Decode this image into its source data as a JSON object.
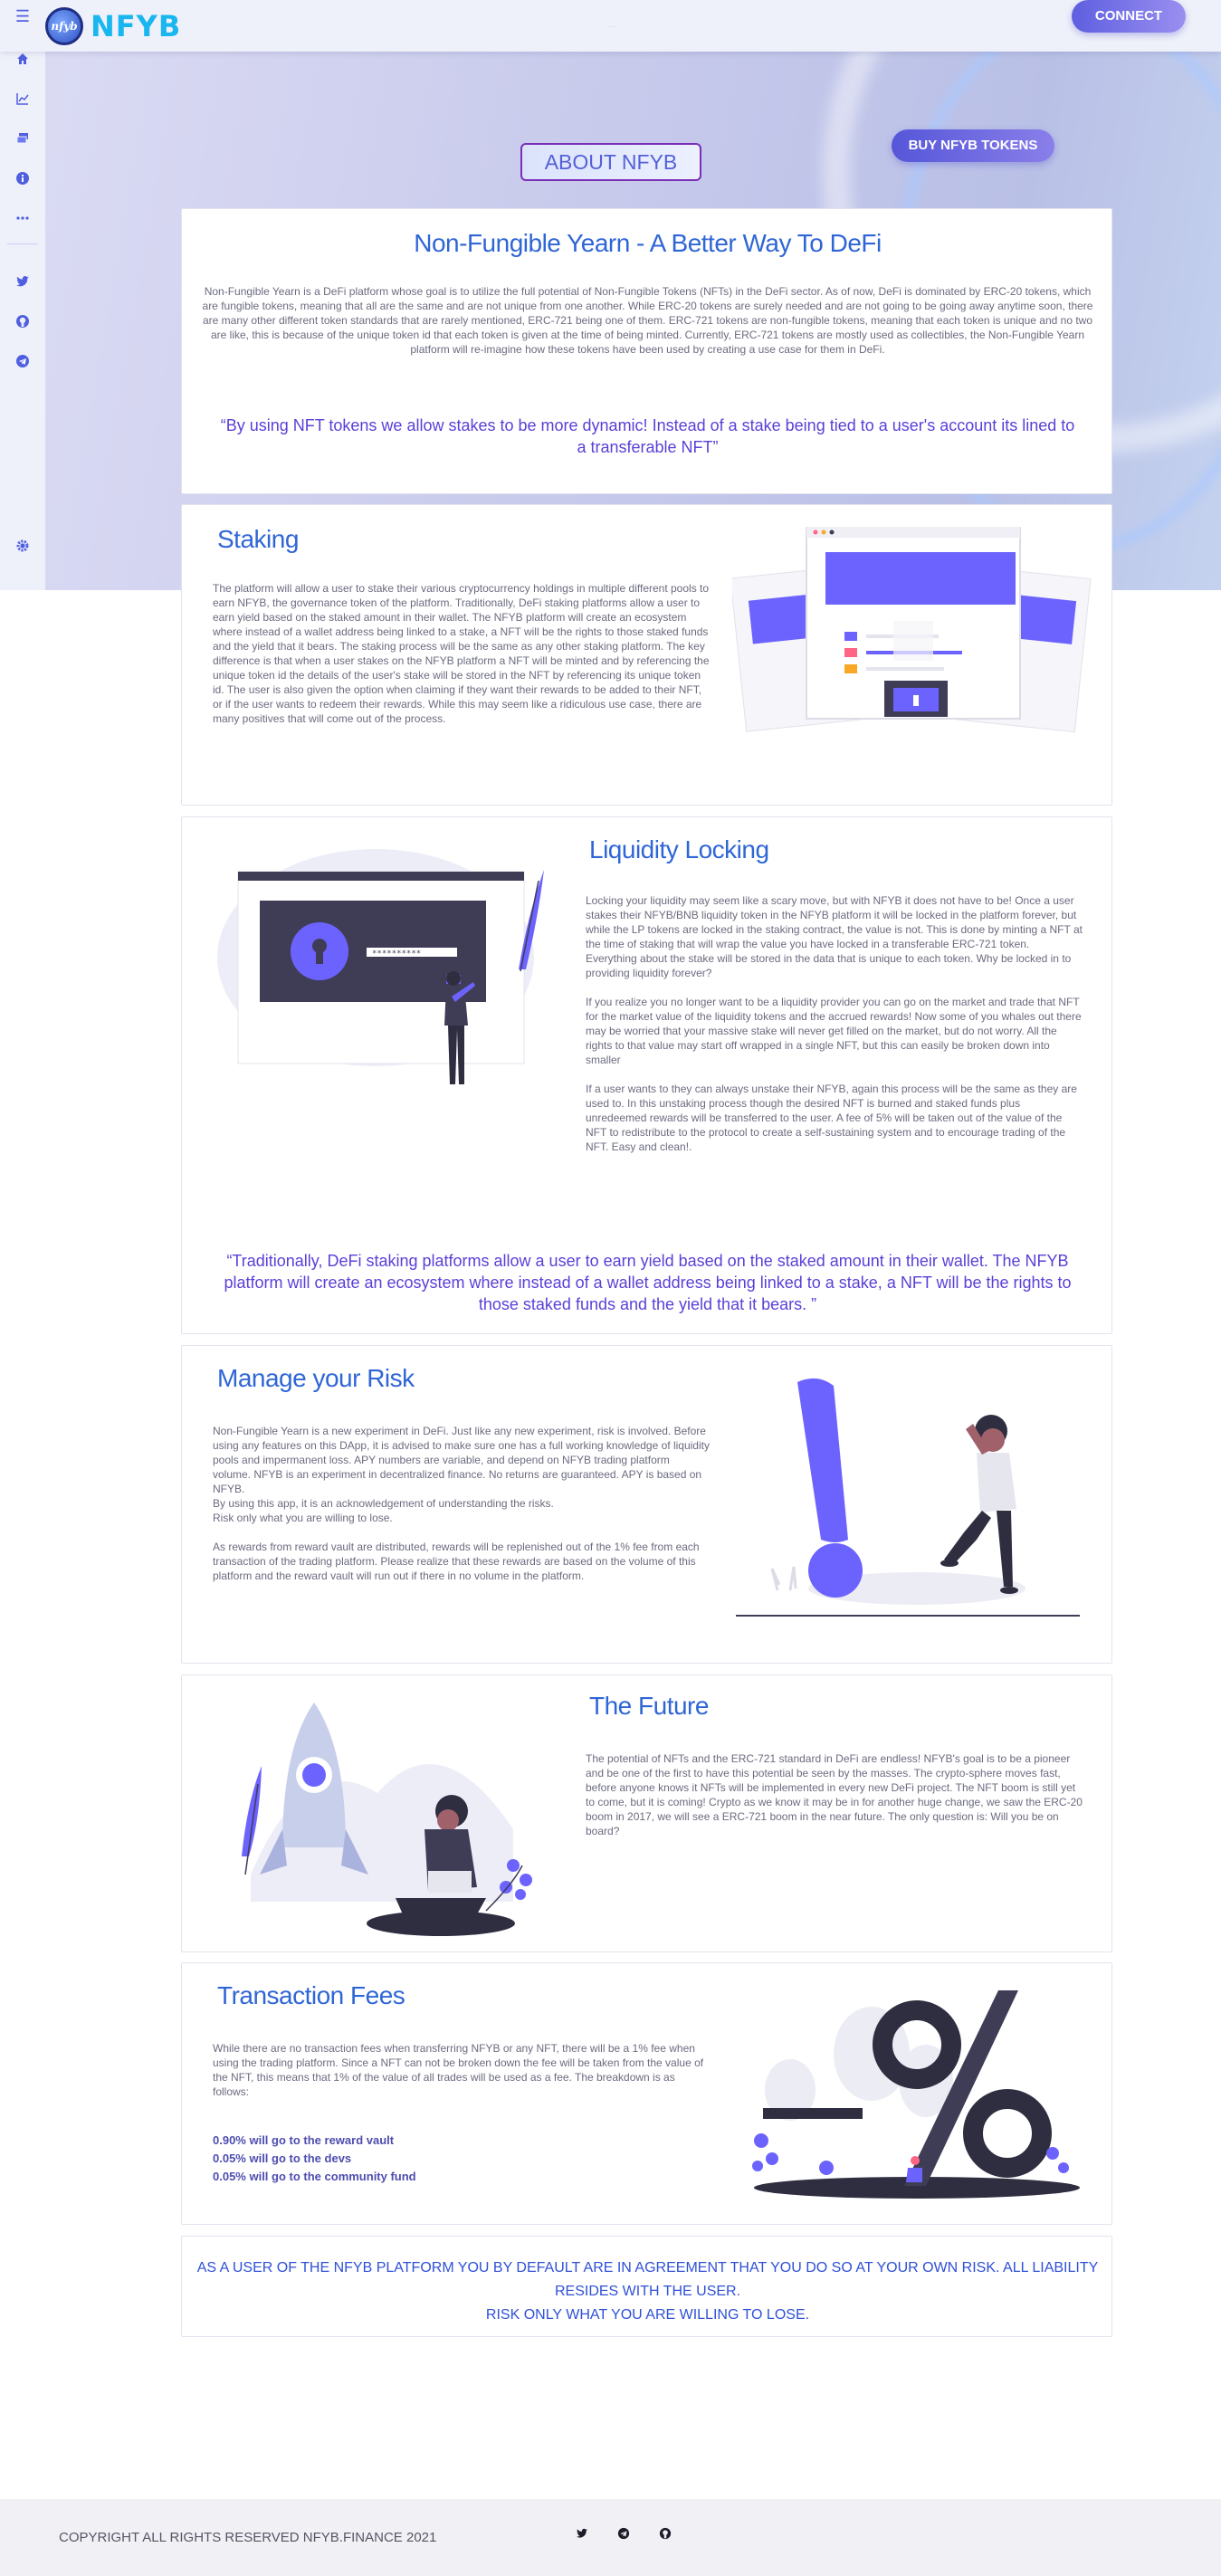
{
  "header": {
    "menu_icon": "menu-icon",
    "logo_text": "nfyb",
    "brand": "NFYB",
    "connect_label": "CONNECT"
  },
  "sidebar": {
    "items": [
      {
        "icon": "home-icon",
        "glyph": "⌂"
      },
      {
        "icon": "chart-icon",
        "glyph": "📈"
      },
      {
        "icon": "layers-icon",
        "glyph": "▤"
      },
      {
        "icon": "info-icon",
        "glyph": "ℹ"
      },
      {
        "icon": "more-icon",
        "glyph": "•••"
      },
      {
        "icon": "twitter-icon",
        "glyph": "🐦"
      },
      {
        "icon": "github-icon",
        "glyph": "◉"
      },
      {
        "icon": "telegram-icon",
        "glyph": "➤"
      },
      {
        "icon": "settings-icon",
        "glyph": "⚙"
      }
    ]
  },
  "hero": {
    "about_label": "ABOUT NFYB",
    "buy_label": "BUY NFYB TOKENS"
  },
  "about": {
    "title": "Non-Fungible Yearn - A Better Way To DeFi",
    "body": "Non-Fungible Yearn is a DeFi platform whose goal is to utilize the full potential of Non-Fungible Tokens (NFTs) in the DeFi sector. As of now, DeFi is dominated by ERC-20 tokens, which are fungible tokens, meaning that all are the same and are not unique from one another. While ERC-20 tokens are surely needed and are not going to be going away anytime soon, there are many other different token standards that are rarely mentioned, ERC-721 being one of them. ERC-721 tokens are non-fungible tokens, meaning that each token is unique and no two are like, this is because of the unique token id that each token is given at the time of being minted. Currently, ERC-721 tokens are mostly used as collectibles, the Non-Fungible Yearn platform will re-imagine how these tokens have been used by creating a use case for them in DeFi.",
    "quote": "“By using NFT tokens we allow stakes to be more dynamic! Instead of a stake being tied to a user's account its lined to a transferable NFT”"
  },
  "staking": {
    "title": "Staking",
    "body": "The platform will allow a user to stake their various cryptocurrency holdings in multiple different pools to earn NFYB, the governance token of the platform. Traditionally, DeFi staking platforms allow a user to earn yield based on the staked amount in their wallet. The NFYB platform will create an ecosystem where instead of a wallet address being linked to a stake, a NFT will be the rights to those staked funds and the yield that it bears. The staking process will be the same as any other staking platform. The key difference is that when a user stakes on the NFYB platform a NFT will be minted and by referencing the unique token id the details of the user's stake will be stored in the NFT by referencing its unique token id. The user is also given the option when claiming if they want their rewards to be added to their NFT, or if the user wants to redeem their rewards. While this may seem like a ridiculous use case, there are many positives that will come out of the process."
  },
  "liquidity": {
    "title": "Liquidity Locking",
    "paragraphs": [
      "Locking your liquidity may seem like a scary move, but with NFYB it does not have to be! Once a user stakes their NFYB/BNB liquidity token in the NFYB platform it will be locked in the platform forever, but while the LP tokens are locked in the staking contract, the value is not. This is done by minting a NFT at the time of staking that will wrap the value you have locked in a transferable ERC-721 token. Everything about the stake will be stored in the data that is unique to each token. Why be locked in to providing liquidity forever?",
      "If you realize you no longer want to be a liquidity provider you can go on the market and trade that NFT for the market value of the liquidity tokens and the accrued rewards! Now some of you whales out there may be worried that your massive stake will never get filled on the market, but do not worry. All the rights to that value may start off wrapped in a single NFT, but this can easily be broken down into smaller",
      "If a user wants to they can always unstake their NFYB, again this process will be the same as they are used to. In this unstaking process though the desired NFT is burned and staked funds plus unredeemed rewards will be transferred to the user. A fee of 5% will be taken out of the value of the NFT to redistribute to the protocol to create a self-sustaining system and to encourage trading of the NFT. Easy and clean!."
    ],
    "quote": "“Traditionally, DeFi staking platforms allow a user to earn yield based on the staked amount in their wallet. The NFYB platform will create an ecosystem where instead of a wallet address being linked to a stake, a NFT will be the rights to those staked funds and the yield that it bears. ”"
  },
  "risk": {
    "title": "Manage your Risk",
    "lines": [
      "Non-Fungible Yearn is a new experiment in DeFi. Just like any new experiment, risk is involved. Before using any features on this DApp, it is advised to make sure one has a full working knowledge of liquidity pools and impermanent loss. APY numbers are variable, and depend on NFYB trading platform volume. NFYB is an experiment in decentralized finance. No returns are guaranteed. APY is based on NFYB.",
      "By using this app, it is an acknowledgement of understanding the risks.",
      "Risk only what you are willing to lose.",
      "As rewards from reward vault are distributed, rewards will be replenished out of the 1% fee from each transaction of the trading platform. Please realize that these rewards are based on the volume of this platform and the reward vault will run out if there in no volume in the platform."
    ]
  },
  "future": {
    "title": "The Future",
    "body": "The potential of NFTs and the ERC-721 standard in DeFi are endless! NFYB's goal is to be a pioneer and be one of the first to have this potential be seen by the masses. The crypto-sphere moves fast, before anyone knows it NFTs will be implemented in every new DeFi project. The NFT boom is still yet to come, but it is coming! Crypto as we know it may be in for another huge change, we saw the ERC-20 boom in 2017, we will see a ERC-721 boom in the near future. The only question is: Will you be on board?"
  },
  "fees": {
    "title": "Transaction Fees",
    "body": "While there are no transaction fees when transferring NFYB or any NFT, there will be a 1% fee when using the trading platform. Since a NFT can not be broken down the fee will be taken from the value of the NFT, this means that 1% of the value of all trades will be used as a fee. The breakdown is as follows:",
    "items": [
      "0.90% will go to the reward vault",
      "0.05% will go to the devs",
      "0.05% will go to the community fund"
    ]
  },
  "disclaimer": {
    "line1": "AS A USER OF THE NFYB PLATFORM YOU BY DEFAULT ARE IN AGREEMENT THAT YOU DO SO AT YOUR OWN RISK. ALL LIABILITY RESIDES WITH THE USER.",
    "line2": "RISK ONLY WHAT YOU ARE WILLING TO LOSE."
  },
  "footer": {
    "copyright": "COPYRIGHT ALL RIGHTS RESERVED NFYB.FINANCE 2021",
    "icons": [
      "twitter-icon",
      "telegram-icon",
      "github-icon"
    ]
  },
  "colors": {
    "accent": "#5e5fe0",
    "title_blue": "#2f66d6",
    "quote_purple": "#5b3fd8"
  }
}
